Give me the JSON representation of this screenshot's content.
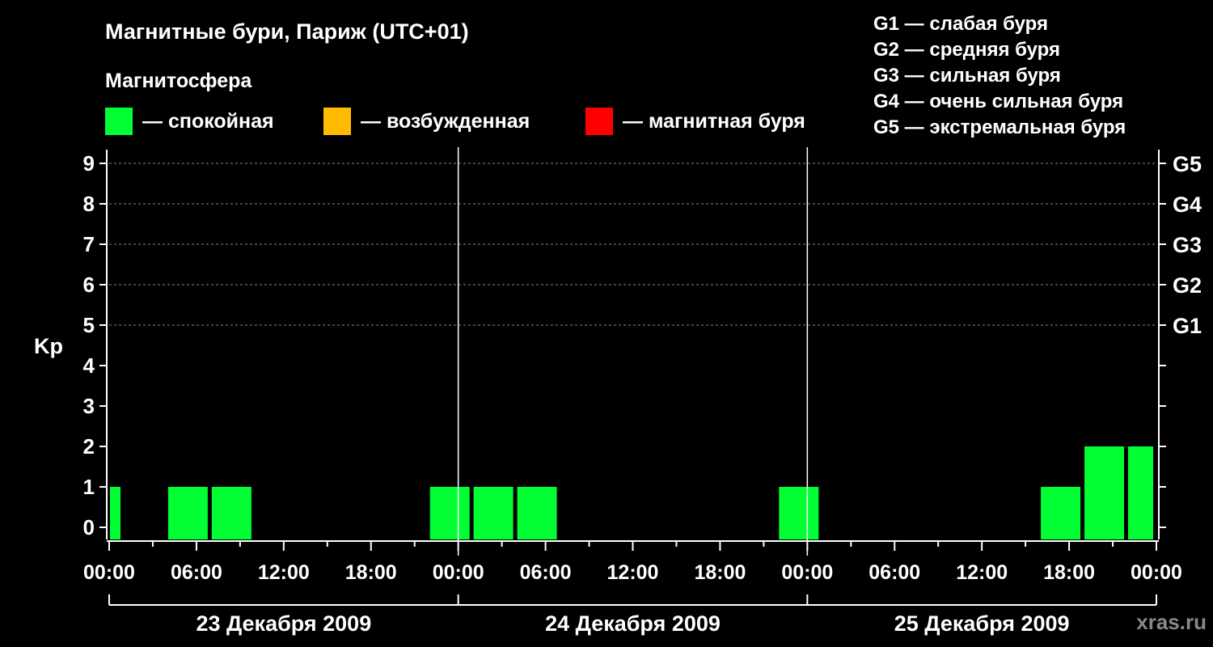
{
  "title": "Магнитные бури, Париж (UTC+01)",
  "subtitle": "Магнитосфера",
  "legend": [
    {
      "label": "— спокойная",
      "color": "#00ff33"
    },
    {
      "label": "— возбужденная",
      "color": "#ffbb00"
    },
    {
      "label": "— магнитная буря",
      "color": "#ff0000"
    }
  ],
  "g_scale": [
    {
      "label": "G1 — слабая буря"
    },
    {
      "label": "G2 — средняя буря"
    },
    {
      "label": "G3 — сильная буря"
    },
    {
      "label": "G4 — очень сильная буря"
    },
    {
      "label": "G5 — экстремальная буря"
    }
  ],
  "watermark": "xras.ru",
  "chart_data": {
    "type": "bar",
    "ylabel": "Kp",
    "ylim": [
      0,
      9
    ],
    "y_ticks": [
      "0",
      "1",
      "2",
      "3",
      "4",
      "5",
      "6",
      "7",
      "8",
      "9"
    ],
    "right_ticks": [
      {
        "kp": 5,
        "label": "G1"
      },
      {
        "kp": 6,
        "label": "G2"
      },
      {
        "kp": 7,
        "label": "G3"
      },
      {
        "kp": 8,
        "label": "G4"
      },
      {
        "kp": 9,
        "label": "G5"
      }
    ],
    "x_ticks": [
      "00:00",
      "06:00",
      "12:00",
      "18:00",
      "00:00",
      "06:00",
      "12:00",
      "18:00",
      "00:00",
      "06:00",
      "12:00",
      "18:00",
      "00:00"
    ],
    "days": [
      "23 Декабря 2009",
      "24 Декабря 2009",
      "25 Декабря 2009"
    ],
    "bar_color": "#00ff33",
    "grid": true,
    "bars": [
      {
        "start_hour": 0,
        "end_hour": 1,
        "kp": 1
      },
      {
        "start_hour": 4,
        "end_hour": 7,
        "kp": 1
      },
      {
        "start_hour": 7,
        "end_hour": 10,
        "kp": 1
      },
      {
        "start_hour": 22,
        "end_hour": 25,
        "kp": 1
      },
      {
        "start_hour": 25,
        "end_hour": 28,
        "kp": 1
      },
      {
        "start_hour": 28,
        "end_hour": 31,
        "kp": 1
      },
      {
        "start_hour": 46,
        "end_hour": 49,
        "kp": 1
      },
      {
        "start_hour": 64,
        "end_hour": 67,
        "kp": 1
      },
      {
        "start_hour": 67,
        "end_hour": 70,
        "kp": 2
      },
      {
        "start_hour": 70,
        "end_hour": 72,
        "kp": 2
      }
    ]
  }
}
